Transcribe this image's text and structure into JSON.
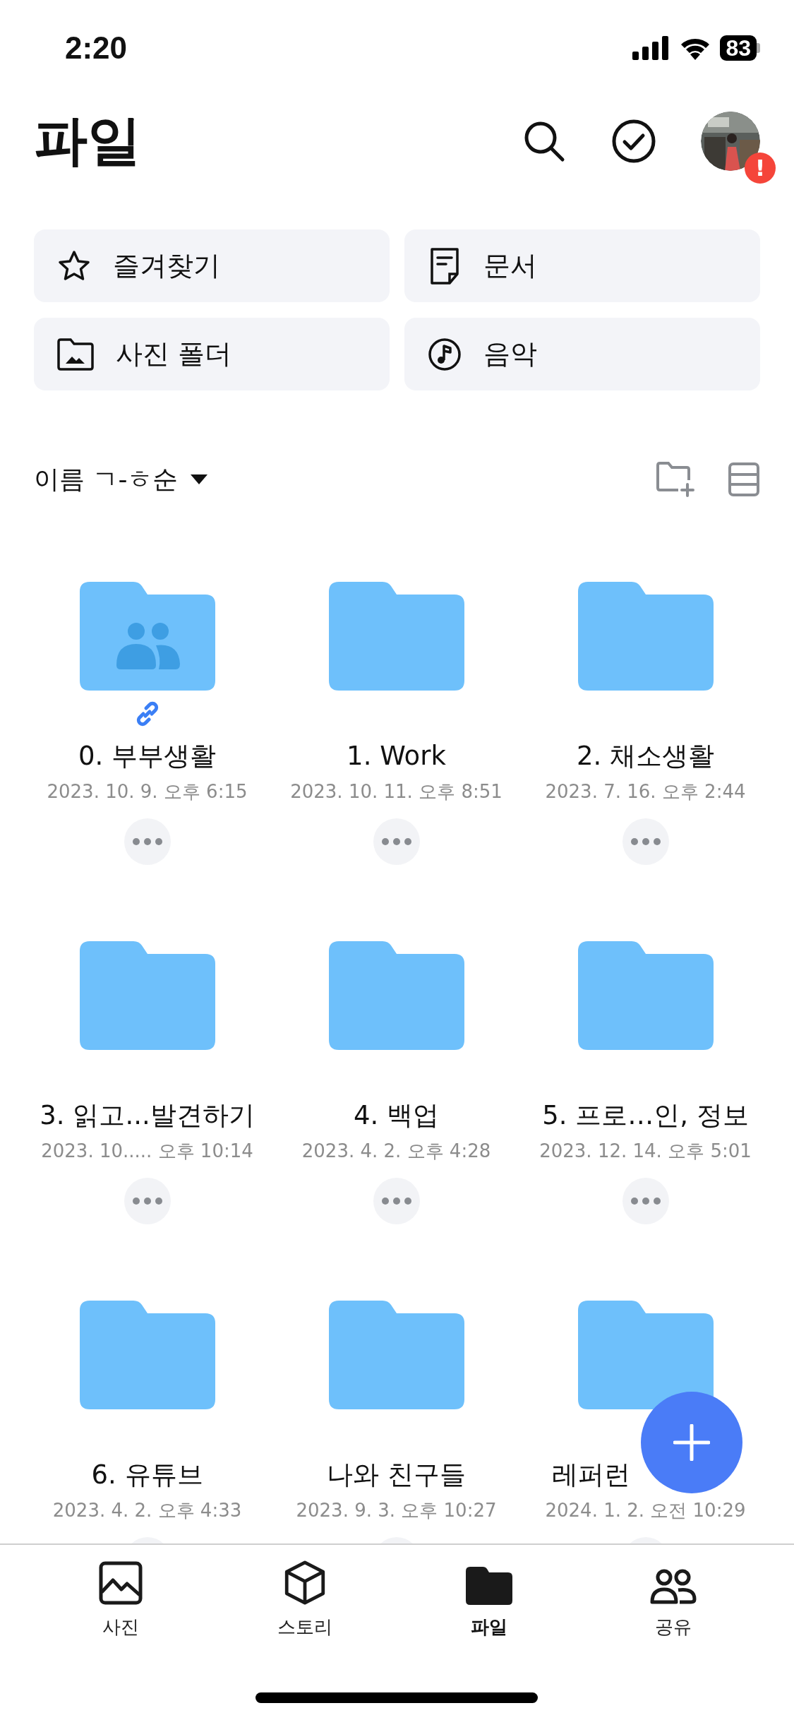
{
  "status_bar": {
    "time": "2:20",
    "battery": "83"
  },
  "header": {
    "title": "파일",
    "avatar": {
      "kind": "picture",
      "badge": "!"
    }
  },
  "shortcuts": [
    {
      "kind": "star",
      "label": "즐겨찾기"
    },
    {
      "kind": "document",
      "label": "문서"
    },
    {
      "kind": "photo-folder",
      "label": "사진 폴더"
    },
    {
      "kind": "music",
      "label": "음악"
    }
  ],
  "sort": {
    "label": "이름 ㄱ-ㅎ순"
  },
  "folders": [
    {
      "name": "0. 부부생활",
      "date": "2023. 10. 9. 오후 6:15",
      "shared": true,
      "linked": true
    },
    {
      "name": "1. Work",
      "date": "2023. 10. 11. 오후 8:51",
      "shared": false,
      "linked": false
    },
    {
      "name": "2. 채소생활",
      "date": "2023. 7. 16. 오후 2:44",
      "shared": false,
      "linked": false
    },
    {
      "name": "3. 읽고...발견하기",
      "date": "2023. 10..... 오후 10:14",
      "shared": false,
      "linked": false
    },
    {
      "name": "4. 백업",
      "date": "2023. 4. 2. 오후 4:28",
      "shared": false,
      "linked": false
    },
    {
      "name": "5. 프로…인, 정보",
      "date": "2023. 12. 14. 오후 5:01",
      "shared": false,
      "linked": false
    },
    {
      "name": "6. 유튜브",
      "date": "2023. 4. 2. 오후 4:33",
      "shared": false,
      "linked": false
    },
    {
      "name": "나와 친구들",
      "date": "2023. 9. 3. 오후 10:27",
      "shared": false,
      "linked": false
    },
    {
      "name": "레퍼런",
      "date": "2024. 1. 2. 오전 10:29",
      "shared": false,
      "linked": false,
      "cut_by_button": true
    }
  ],
  "tabs": [
    {
      "label": "사진",
      "selected": false
    },
    {
      "kind": "story",
      "label": "스토리",
      "selected": false
    },
    {
      "kind": "files",
      "label": "파일",
      "selected": true
    },
    {
      "kind": "share",
      "label": "공유",
      "selected": false
    }
  ]
}
